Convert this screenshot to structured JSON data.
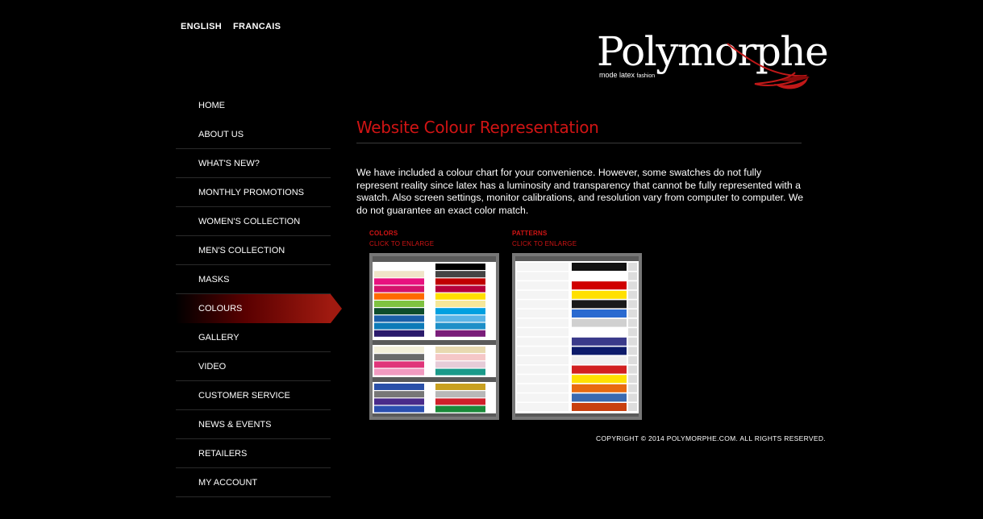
{
  "languages": [
    "ENGLISH",
    "FRANCAIS"
  ],
  "logo": {
    "name": "Polymorphe",
    "tagline_main": "mode latex",
    "tagline_small": "fashion"
  },
  "nav": {
    "items": [
      {
        "label": "HOME"
      },
      {
        "label": "ABOUT US"
      },
      {
        "label": "WHAT'S NEW?"
      },
      {
        "label": "MONTHLY PROMOTIONS"
      },
      {
        "label": "WOMEN'S COLLECTION"
      },
      {
        "label": "MEN'S COLLECTION"
      },
      {
        "label": "MASKS"
      },
      {
        "label": "COLOURS",
        "active": true
      },
      {
        "label": "GALLERY"
      },
      {
        "label": "VIDEO"
      },
      {
        "label": "CUSTOMER SERVICE"
      },
      {
        "label": "NEWS & EVENTS"
      },
      {
        "label": "RETAILERS"
      },
      {
        "label": "MY ACCOUNT"
      }
    ]
  },
  "main": {
    "title": "Website Colour Representation",
    "intro": "We have included a colour chart for your convenience.  However, some swatches do not fully represent reality since latex has a luminosity and transparency that cannot be fully represented with a swatch.  Also screen settings, monitor calibrations, and resolution vary from computer to computer. We do not guarantee an exact color match.",
    "colors": {
      "label": "COLORS",
      "link": "CLICK TO ENLARGE"
    },
    "patterns": {
      "label": "PATTERNS",
      "link": "CLICK TO ENLARGE"
    }
  },
  "footer": {
    "copyright": "COPYRIGHT © 2014 POLYMORPHE.COM. ALL RIGHTS RESERVED."
  },
  "colors_swatches": {
    "left": [
      "#ffffff",
      "#f0e4c8",
      "#e8117f",
      "#d4126b",
      "#ff6a00",
      "#7fc241",
      "#0e4d2c",
      "#1a5fa8",
      "#0c7ab8",
      "#2a1a6b"
    ],
    "right": [
      "#000000",
      "#444444",
      "#c00000",
      "#b5003a",
      "#ffe000",
      "#f6e79a",
      "#00a0e0",
      "#5ab4e6",
      "#1e8fc8",
      "#7a1d7a"
    ],
    "left2": [
      "#f3efd9",
      "#6a6a6a",
      "#e0357a",
      "#f19ac0"
    ],
    "right2": [
      "#e8d9b0",
      "#f5c7c7",
      "#e6ccd8",
      "#1a9a8a"
    ],
    "left3": [
      "#2a50a8",
      "#777777",
      "#4a2b8a",
      "#2b4fb0"
    ],
    "right3": [
      "#c8a020",
      "#b8b8b8",
      "#d0202a",
      "#1a8a3a"
    ]
  },
  "pattern_swatches": [
    "#111111",
    "#ffffff",
    "#d00000",
    "#ffe000",
    "#1a1a1a",
    "#2a6ad0",
    "#d0d0d0",
    "#ffffff",
    "#3a3a8a",
    "#0c1a6a",
    "#f0f0f0",
    "#d22020",
    "#ffe000",
    "#e86a10",
    "#3a6ab0",
    "#c84010"
  ]
}
